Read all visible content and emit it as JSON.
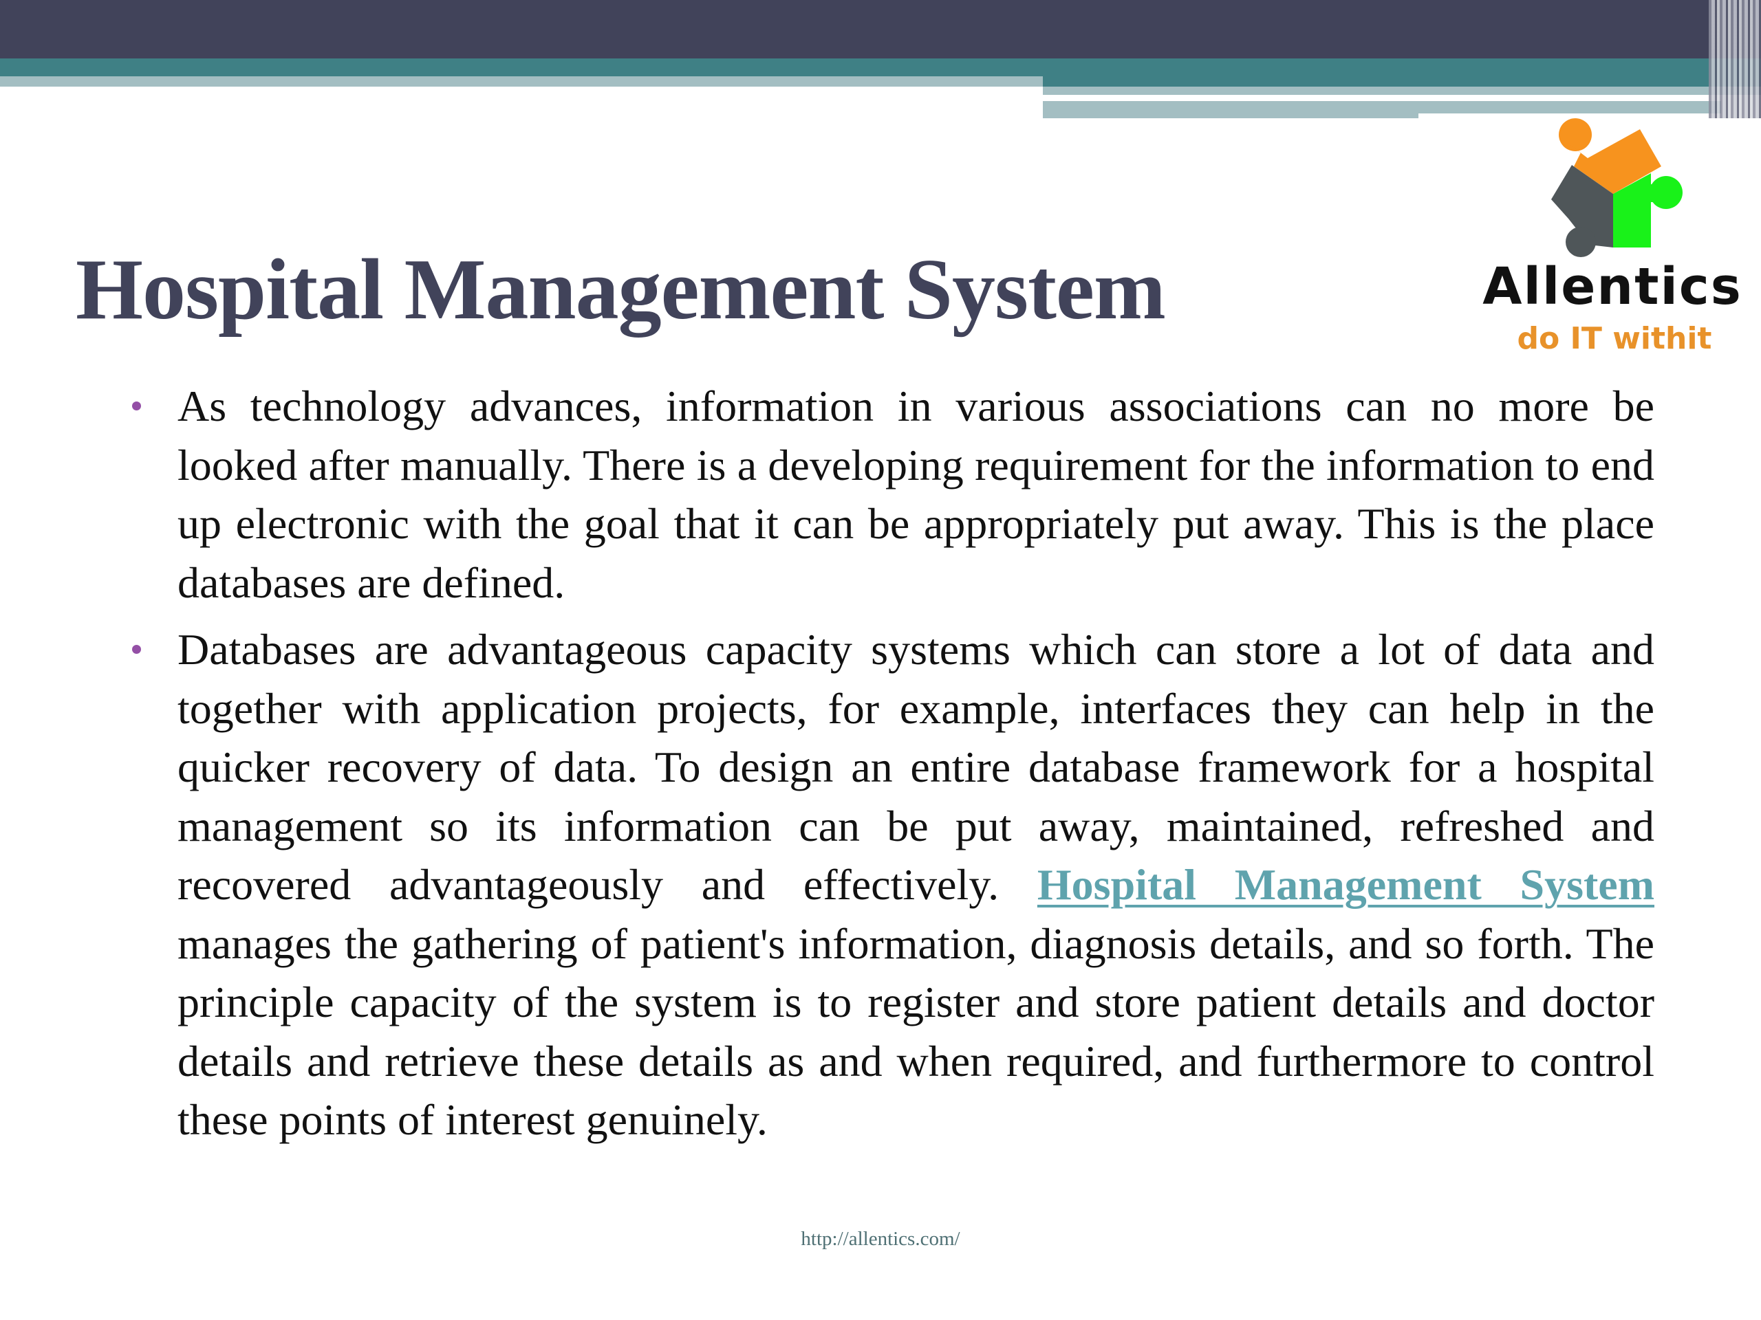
{
  "slide": {
    "title": "Hospital Management System",
    "colors": {
      "header_dark": "#41435a",
      "header_teal": "#3f8085",
      "header_light": "#a3bec2",
      "title": "#41435a",
      "bullet": "#944fa6",
      "link": "#5fa3ad",
      "logo_orange": "#f7931e",
      "logo_grey": "#4f5659",
      "logo_green": "#19f219"
    }
  },
  "logo": {
    "icon": "puzzle-pieces-icon",
    "name": "Allentics",
    "tagline": "do IT withit"
  },
  "bullets": [
    {
      "text": "As technology advances, information in various associations can no more be looked after manually. There is a developing requirement for the information to end up electronic with the goal that it can be appropriately put away. This is the place databases are defined."
    },
    {
      "text_before": "Databases are advantageous capacity systems which can store a lot of data and together with application projects, for example, interfaces they can help in the quicker recovery of data. To design an entire database framework for a hospital management so its information can be put away, maintained, refreshed and recovered advantageously and effectively.",
      "link_text": "Hospital Management System",
      "text_after": "manages the gathering of patient's information, diagnosis details, and so forth. The principle capacity of the system is to register and store patient details and doctor details and retrieve these details as and when required, and furthermore to control these points of interest genuinely."
    }
  ],
  "footer": {
    "url": "http://allentics.com/"
  }
}
